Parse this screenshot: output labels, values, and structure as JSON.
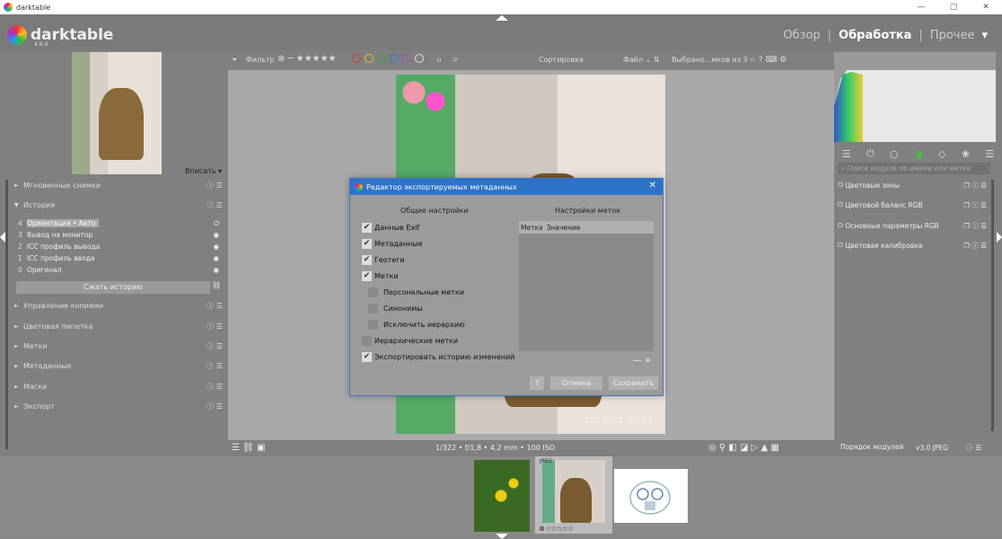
{
  "window": {
    "title": "darktable",
    "controls": [
      "—",
      "▢",
      "✕"
    ]
  },
  "brand": {
    "name": "darktable",
    "version": "4.6.0"
  },
  "views": {
    "lighttable": "Обзор",
    "darkroom": "Обработка",
    "other": "Прочее",
    "sep": "|",
    "dropdown": "▾"
  },
  "left": {
    "fit_label": "Вписать",
    "fit_arrow": "▾",
    "sections": {
      "snapshots": "Мгновенные снимки",
      "history": "История",
      "duplicates": "Управление копиями",
      "color_picker": "Цветовая пипетка",
      "tags": "Метки",
      "metadata": "Метаданные",
      "masks": "Маски",
      "export": "Экспорт"
    },
    "history_items": [
      {
        "num": "4",
        "label": "Ориентация • Авто",
        "icon": "⏻"
      },
      {
        "num": "3",
        "label": "Вывод на монитор",
        "icon": "◉"
      },
      {
        "num": "2",
        "label": "ICC профиль вывода",
        "icon": "◉"
      },
      {
        "num": "1",
        "label": "ICC профиль ввода",
        "icon": "◉"
      },
      {
        "num": "0",
        "label": "Оригинал",
        "icon": "◉"
      }
    ],
    "compress_button": "Сжать историю",
    "section_icons": "ⓘ ☰",
    "arrow_collapsed": "►",
    "arrow_expanded": "▼"
  },
  "filterbar": {
    "filter_label": "Фильтр",
    "stars": "⊗ ─ ★★★★★",
    "sort_label": "Сортировка",
    "sort_value": "Файл",
    "selected_text": "Выбрано...мков из 3",
    "icons": "☆ ? ⌨ ⚙",
    "search_icon": "🔍"
  },
  "filter_dot_colors": [
    "#e03030",
    "#e0c020",
    "#30b030",
    "#3070e0",
    "#b040d0",
    "#dddddd"
  ],
  "photo": {
    "datestamp": "2023/7/1 16:07"
  },
  "bottombar": {
    "exif": "1/322 • f/1,8 • 4,2 mm • 100 ISO",
    "left_icons": "☰ ⛓ ▣",
    "right_icons": "◎ ⚲ ◧ ◪ ▷ ▲ ▦"
  },
  "right": {
    "search_placeholder": "Поиск модуля по имени или метке",
    "modules": [
      {
        "label": "Цветовые зоны",
        "icons": "❐ ⓘ ☰"
      },
      {
        "label": "Цветовой баланс RGB",
        "icons": "❐ ⓘ ☰"
      },
      {
        "label": "Основные параметры RGB",
        "icons": "❐ ⓘ ☰"
      },
      {
        "label": "Цветовая калибровка",
        "icons": "❐ ⓘ ☰"
      }
    ],
    "power_icon": "⏻",
    "module_order_label": "Порядок модулей",
    "module_order_value": "v3.0 JPEG",
    "module_order_icons": "ⓘ ☰",
    "tab_icons": [
      "☰",
      "⏻",
      "○",
      "◑",
      "◇",
      "❀",
      "☰"
    ]
  },
  "filmstrip": {
    "jpeg_label": "JPEG",
    "stars": "⊗ ☆☆☆☆☆"
  },
  "dialog": {
    "title": "Редактор экспортируемых метаданных",
    "close": "✕",
    "general_header": "Общие настройки",
    "tags_header": "Настройки меток",
    "options": [
      {
        "label": "Данные Exif",
        "checked": true
      },
      {
        "label": "Метаданные",
        "checked": true
      },
      {
        "label": "Геотеги",
        "checked": true
      },
      {
        "label": "Метки",
        "checked": true
      },
      {
        "label": "Персональные метки",
        "checked": false
      },
      {
        "label": "Синонимы",
        "checked": false
      },
      {
        "label": "Исключить иерархию",
        "checked": false
      },
      {
        "label": "Иерархические метки",
        "checked": false
      },
      {
        "label": "Экспортировать историю изменений",
        "checked": true
      }
    ],
    "tag_columns": [
      "Метка",
      "Значение"
    ],
    "remove_add": "— +",
    "help_button": "?",
    "cancel_button": "Отмена",
    "save_button": "Сохранить"
  }
}
